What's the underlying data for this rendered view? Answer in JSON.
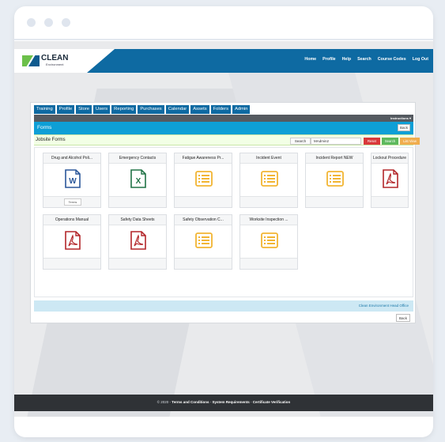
{
  "header": {
    "logo_text": "CLEAN",
    "logo_sub": "Environment",
    "nav": [
      "Home",
      "Profile",
      "Help",
      "Search",
      "Course Codes",
      "Log Out"
    ]
  },
  "tabs": [
    "Training",
    "Profile",
    "Store",
    "Users",
    "Reporting",
    "Purchases",
    "Calendar",
    "Assets",
    "Folders",
    "Admin"
  ],
  "instructions_label": "Instructions ▾",
  "section_title": "Forms",
  "back_label": "Back",
  "jobsite": {
    "title": "Jobsite Forms",
    "search_label": "Search",
    "search_value": "MAdmin2",
    "reset_label": "Reset",
    "search_button": "Search",
    "list_view_label": "List View"
  },
  "cards": [
    {
      "title": "Drug and Alcohol Poli...",
      "icon": "word-icon",
      "footer_button": "Terms"
    },
    {
      "title": "Emergency Contacts",
      "icon": "excel-icon"
    },
    {
      "title": "Fatigue Awareness Pr...",
      "icon": "form-icon"
    },
    {
      "title": "Incident Event",
      "icon": "form-icon"
    },
    {
      "title": "Incident Report NEW",
      "icon": "form-icon"
    },
    {
      "title": "Lockout Procedure",
      "icon": "pdf-icon"
    },
    {
      "title": "Operations Manual",
      "icon": "pdf-icon"
    },
    {
      "title": "Safety Data Sheets",
      "icon": "pdf-icon"
    },
    {
      "title": "Safety Observation C...",
      "icon": "form-icon"
    },
    {
      "title": "Worksite Inspection ...",
      "icon": "form-icon"
    }
  ],
  "office_label": "Clean Environment Head Office",
  "footer": {
    "year": "© 2020 -",
    "links": [
      "Terms and Conditions",
      "System Requirements",
      "Certificate Verification"
    ]
  },
  "colors": {
    "primary": "#0e6aa2",
    "accent": "#0e9fd6",
    "reset": "#d9383a",
    "search": "#5cb85c",
    "list_view": "#f0ad4e"
  }
}
